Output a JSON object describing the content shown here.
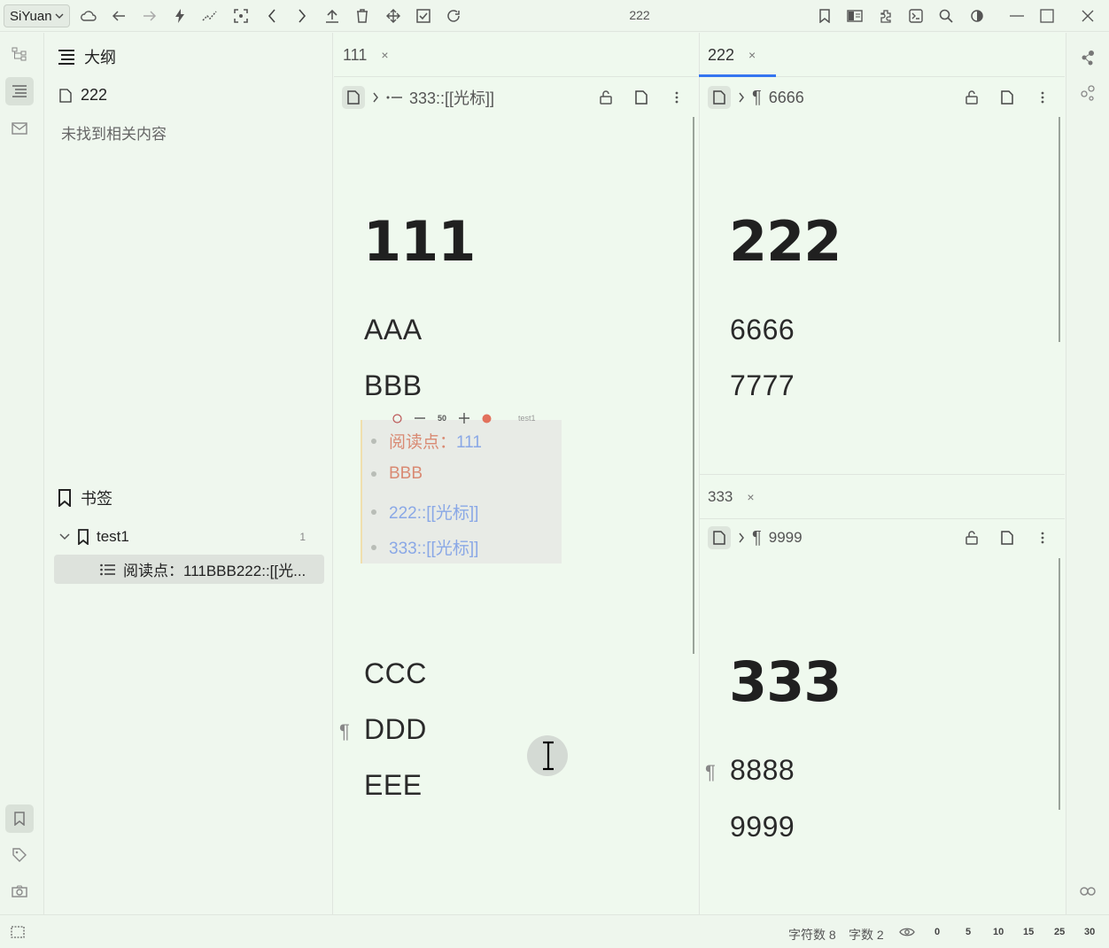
{
  "app": {
    "brand": "SiYuan",
    "window_title": "222"
  },
  "outline": {
    "title": "大纲",
    "doc_name": "222",
    "empty_text": "未找到相关内容"
  },
  "bookmarks": {
    "title": "书签",
    "group_name": "test1",
    "group_count": "1",
    "item_label": "阅读点：111BBB222::[[光..."
  },
  "pane_left": {
    "tab_label": "111",
    "tab_close": "×",
    "breadcrumb": "333::[[光标]]",
    "heading": "111",
    "paragraphs": [
      "AAA",
      "BBB",
      "CCC",
      "DDD",
      "EEE"
    ],
    "pilcrow": "¶",
    "embed": {
      "toolbar_zoom": "50",
      "toolbar_name": "test1",
      "items": [
        {
          "prefix": "阅读点：",
          "link": "111"
        },
        {
          "prefix": "BBB",
          "link": ""
        },
        {
          "prefix": "",
          "link": "222::[[光标]]"
        },
        {
          "prefix": "",
          "link": "333::[[光标]]"
        }
      ]
    }
  },
  "pane_right_top": {
    "tab_label": "222",
    "tab_close": "×",
    "breadcrumb_symbol": "¶",
    "breadcrumb": "6666",
    "heading": "222",
    "paragraphs": [
      "6666",
      "7777"
    ]
  },
  "pane_right_bottom": {
    "tab_label": "333",
    "tab_close": "×",
    "breadcrumb_symbol": "¶",
    "breadcrumb": "9999",
    "heading": "333",
    "paragraphs": [
      "8888",
      "9999"
    ],
    "pilcrow": "¶"
  },
  "status": {
    "char_count": "字符数 8",
    "word_count": "字数 2",
    "scale": [
      "0",
      "5",
      "10",
      "15",
      "25",
      "30"
    ]
  },
  "colors": {
    "accent": "#3575f0",
    "embed_orange": "#d98a73",
    "embed_blue": "#8aa8e6"
  }
}
